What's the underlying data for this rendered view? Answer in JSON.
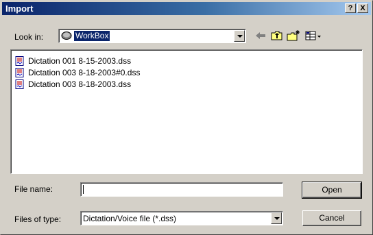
{
  "window": {
    "title": "Import",
    "help_label": "?",
    "close_label": "X"
  },
  "lookin": {
    "label": "Look in:",
    "value": "WorkBox",
    "folder_icon": "drive-folder-icon"
  },
  "toolbar": {
    "back_icon": "back-arrow-icon",
    "up_icon": "up-folder-icon",
    "new_folder_icon": "new-folder-icon",
    "view_icon": "view-menu-icon"
  },
  "files": [
    {
      "name": "Dictation 001 8-15-2003.dss"
    },
    {
      "name": "Dictation 003 8-18-2003#0.dss"
    },
    {
      "name": "Dictation 003 8-18-2003.dss"
    }
  ],
  "filename": {
    "label": "File name:",
    "value": ""
  },
  "filetype": {
    "label": "Files of type:",
    "value": "Dictation/Voice file (*.dss)"
  },
  "buttons": {
    "open": "Open",
    "cancel": "Cancel"
  },
  "colors": {
    "title_gradient_start": "#0a246a",
    "title_gradient_end": "#a6caf0",
    "selection": "#0a246a",
    "face": "#d4d0c8"
  }
}
